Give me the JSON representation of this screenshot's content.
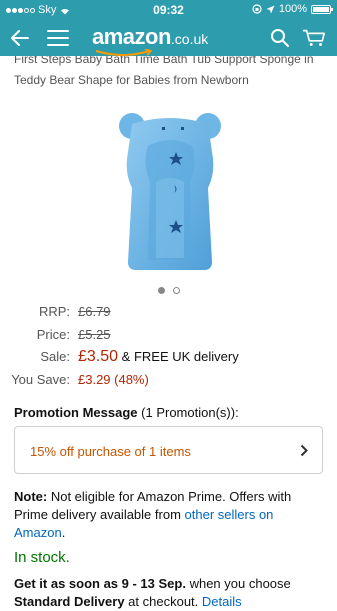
{
  "status": {
    "carrier": "Sky",
    "time": "09:32",
    "battery": "100%"
  },
  "nav": {
    "brand": "amazon",
    "tld": ".co.uk"
  },
  "product": {
    "title_line1": "First Steps Baby Bath Time Bath Tub Support Sponge in",
    "title_line2": "Teddy Bear Shape for Babies from Newborn",
    "image_color": "#6eb6e6",
    "image_count": 2,
    "active_image": 1
  },
  "prices": {
    "rrp_label": "RRP:",
    "rrp_value": "£6.79",
    "price_label": "Price:",
    "price_value": "£5.25",
    "sale_label": "Sale:",
    "sale_value": "£3.50",
    "delivery_text": "& FREE UK delivery",
    "save_label": "You Save:",
    "save_value": "£3.29 (48%)"
  },
  "promotion": {
    "heading": "Promotion Message",
    "count_text": "(1 Promotion(s)):",
    "offer": "15% off purchase of 1 items"
  },
  "prime_note": {
    "label": "Note:",
    "text": "Not eligible for Amazon Prime. Offers with Prime delivery available from",
    "link": "other sellers on Amazon",
    "end": "."
  },
  "availability": {
    "stock": "In stock."
  },
  "delivery": {
    "lead": "Get it as soon as 9 - 13 Sep.",
    "rest": "when you choose",
    "option": "Standard Delivery",
    "rest2": "at checkout.",
    "details_link": "Details"
  },
  "colors": {
    "header": "#2d9cad",
    "sale_red": "#b12704",
    "promo_orange": "#c45500",
    "link_blue": "#0066c0",
    "stock_green": "#007600"
  }
}
